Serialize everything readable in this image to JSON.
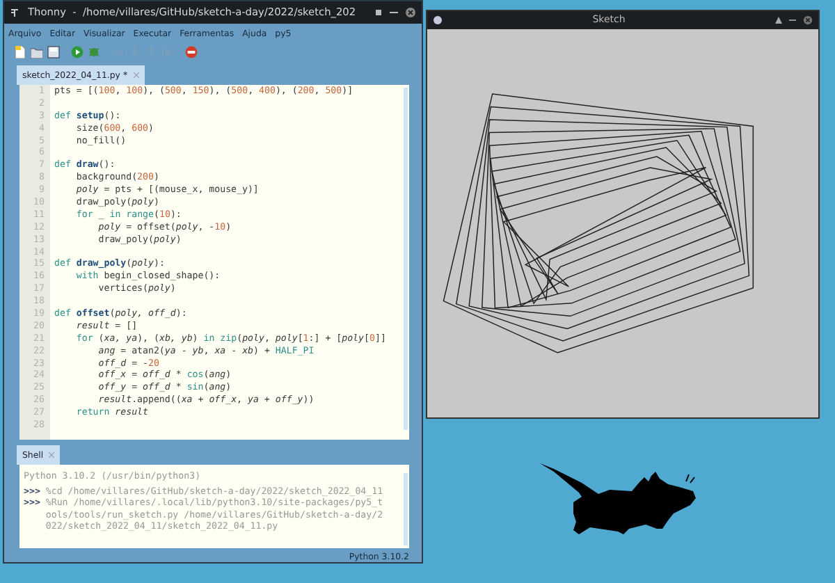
{
  "thonny_window": {
    "title": "Thonny  -  /home/villares/GitHub/sketch-a-day/2022/sketch_202",
    "menu": [
      "Arquivo",
      "Editar",
      "Visualizar",
      "Executar",
      "Ferramentas",
      "Ajuda",
      "py5"
    ],
    "toolbar": [
      {
        "kind": "new",
        "disabled": false
      },
      {
        "kind": "open",
        "disabled": false
      },
      {
        "kind": "save",
        "disabled": false
      },
      {
        "kind": "run",
        "disabled": false
      },
      {
        "kind": "debug",
        "disabled": false
      },
      {
        "kind": "step-over",
        "disabled": true
      },
      {
        "kind": "step-into",
        "disabled": true
      },
      {
        "kind": "step-out",
        "disabled": true
      },
      {
        "kind": "resume",
        "disabled": true
      },
      {
        "kind": "stop",
        "disabled": false
      }
    ],
    "editor_tabs": [
      {
        "label": "sketch_2022_04_11.py *",
        "selected": true
      }
    ],
    "code_lines": [
      {
        "number": "1",
        "tokens": [
          {
            "kind": "pl",
            "text": "pts = [("
          },
          {
            "kind": "num",
            "text": "100"
          },
          {
            "kind": "pl",
            "text": ", "
          },
          {
            "kind": "num",
            "text": "100"
          },
          {
            "kind": "pl",
            "text": "), ("
          },
          {
            "kind": "num",
            "text": "500"
          },
          {
            "kind": "pl",
            "text": ", "
          },
          {
            "kind": "num",
            "text": "150"
          },
          {
            "kind": "pl",
            "text": "), ("
          },
          {
            "kind": "num",
            "text": "500"
          },
          {
            "kind": "pl",
            "text": ", "
          },
          {
            "kind": "num",
            "text": "400"
          },
          {
            "kind": "pl",
            "text": "), ("
          },
          {
            "kind": "num",
            "text": "200"
          },
          {
            "kind": "pl",
            "text": ", "
          },
          {
            "kind": "num",
            "text": "500"
          },
          {
            "kind": "pl",
            "text": ")]"
          }
        ]
      },
      {
        "number": "2"
      },
      {
        "number": "3",
        "tokens": [
          {
            "kind": "kw",
            "text": "def "
          },
          {
            "kind": "fn",
            "text": "setup"
          },
          {
            "kind": "pl",
            "text": "():"
          }
        ]
      },
      {
        "number": "4",
        "tokens": [
          {
            "kind": "pl",
            "text": "    size("
          },
          {
            "kind": "num",
            "text": "600"
          },
          {
            "kind": "pl",
            "text": ", "
          },
          {
            "kind": "num",
            "text": "600"
          },
          {
            "kind": "pl",
            "text": ")"
          }
        ]
      },
      {
        "number": "5",
        "tokens": [
          {
            "kind": "pl",
            "text": "    no_fill()"
          }
        ]
      },
      {
        "number": "6"
      },
      {
        "number": "7",
        "tokens": [
          {
            "kind": "kw",
            "text": "def "
          },
          {
            "kind": "fn",
            "text": "draw"
          },
          {
            "kind": "pl",
            "text": "():"
          }
        ]
      },
      {
        "number": "8",
        "tokens": [
          {
            "kind": "pl",
            "text": "    background("
          },
          {
            "kind": "num",
            "text": "200"
          },
          {
            "kind": "pl",
            "text": ")"
          }
        ]
      },
      {
        "number": "9",
        "tokens": [
          {
            "kind": "it",
            "text": "    poly"
          },
          {
            "kind": "pl",
            "text": " = pts + [(mouse_x, mouse_y)]"
          }
        ]
      },
      {
        "number": "10",
        "tokens": [
          {
            "kind": "pl",
            "text": "    draw_poly("
          },
          {
            "kind": "it",
            "text": "poly"
          },
          {
            "kind": "pl",
            "text": ")"
          }
        ]
      },
      {
        "number": "11",
        "tokens": [
          {
            "kind": "kw",
            "text": "    for"
          },
          {
            "kind": "pl",
            "text": " _ "
          },
          {
            "kind": "kw",
            "text": "in"
          },
          {
            "kind": "bi",
            "text": " range"
          },
          {
            "kind": "pl",
            "text": "("
          },
          {
            "kind": "num",
            "text": "10"
          },
          {
            "kind": "pl",
            "text": "):"
          }
        ]
      },
      {
        "number": "12",
        "tokens": [
          {
            "kind": "it",
            "text": "        poly"
          },
          {
            "kind": "pl",
            "text": " = offset("
          },
          {
            "kind": "it",
            "text": "poly"
          },
          {
            "kind": "pl",
            "text": ", -"
          },
          {
            "kind": "num",
            "text": "10"
          },
          {
            "kind": "pl",
            "text": ")"
          }
        ]
      },
      {
        "number": "13",
        "tokens": [
          {
            "kind": "pl",
            "text": "        draw_poly("
          },
          {
            "kind": "it",
            "text": "poly"
          },
          {
            "kind": "pl",
            "text": ")"
          }
        ]
      },
      {
        "number": "14"
      },
      {
        "number": "15",
        "tokens": [
          {
            "kind": "kw",
            "text": "def "
          },
          {
            "kind": "fn",
            "text": "draw_poly"
          },
          {
            "kind": "pl",
            "text": "("
          },
          {
            "kind": "it",
            "text": "poly"
          },
          {
            "kind": "pl",
            "text": "):"
          }
        ]
      },
      {
        "number": "16",
        "tokens": [
          {
            "kind": "kw",
            "text": "    with"
          },
          {
            "kind": "pl",
            "text": " begin_closed_shape():"
          }
        ]
      },
      {
        "number": "17",
        "tokens": [
          {
            "kind": "pl",
            "text": "        vertices("
          },
          {
            "kind": "it",
            "text": "poly"
          },
          {
            "kind": "pl",
            "text": ")"
          }
        ]
      },
      {
        "number": "18"
      },
      {
        "number": "19",
        "tokens": [
          {
            "kind": "kw",
            "text": "def "
          },
          {
            "kind": "fn",
            "text": "offset"
          },
          {
            "kind": "pl",
            "text": "("
          },
          {
            "kind": "it",
            "text": "poly, off_d"
          },
          {
            "kind": "pl",
            "text": "):"
          }
        ]
      },
      {
        "number": "20",
        "tokens": [
          {
            "kind": "it",
            "text": "    result"
          },
          {
            "kind": "pl",
            "text": " = []"
          }
        ]
      },
      {
        "number": "21",
        "tokens": [
          {
            "kind": "kw",
            "text": "    for"
          },
          {
            "kind": "pl",
            "text": " ("
          },
          {
            "kind": "it",
            "text": "xa, ya"
          },
          {
            "kind": "pl",
            "text": "), ("
          },
          {
            "kind": "it",
            "text": "xb, yb"
          },
          {
            "kind": "pl",
            "text": ") "
          },
          {
            "kind": "kw",
            "text": "in"
          },
          {
            "kind": "bi",
            "text": " zip"
          },
          {
            "kind": "pl",
            "text": "("
          },
          {
            "kind": "it",
            "text": "poly"
          },
          {
            "kind": "pl",
            "text": ", "
          },
          {
            "kind": "it",
            "text": "poly"
          },
          {
            "kind": "pl",
            "text": "["
          },
          {
            "kind": "num",
            "text": "1"
          },
          {
            "kind": "pl",
            "text": ":] + ["
          },
          {
            "kind": "it",
            "text": "poly"
          },
          {
            "kind": "pl",
            "text": "["
          },
          {
            "kind": "num",
            "text": "0"
          },
          {
            "kind": "pl",
            "text": "]]"
          }
        ]
      },
      {
        "number": "22",
        "tokens": [
          {
            "kind": "it",
            "text": "        ang"
          },
          {
            "kind": "pl",
            "text": " = atan2("
          },
          {
            "kind": "it",
            "text": "ya"
          },
          {
            "kind": "pl",
            "text": " - "
          },
          {
            "kind": "it",
            "text": "yb"
          },
          {
            "kind": "pl",
            "text": ", "
          },
          {
            "kind": "it",
            "text": "xa"
          },
          {
            "kind": "pl",
            "text": " - "
          },
          {
            "kind": "it",
            "text": "xb"
          },
          {
            "kind": "pl",
            "text": ") + "
          },
          {
            "kind": "bi",
            "text": "HALF_PI"
          }
        ]
      },
      {
        "number": "23",
        "tokens": [
          {
            "kind": "it",
            "text": "        off_d"
          },
          {
            "kind": "pl",
            "text": " = -"
          },
          {
            "kind": "num",
            "text": "20"
          }
        ]
      },
      {
        "number": "24",
        "tokens": [
          {
            "kind": "it",
            "text": "        off_x"
          },
          {
            "kind": "pl",
            "text": " = "
          },
          {
            "kind": "it",
            "text": "off_d"
          },
          {
            "kind": "pl",
            "text": " * "
          },
          {
            "kind": "bi",
            "text": "cos"
          },
          {
            "kind": "pl",
            "text": "("
          },
          {
            "kind": "it",
            "text": "ang"
          },
          {
            "kind": "pl",
            "text": ")"
          }
        ]
      },
      {
        "number": "25",
        "tokens": [
          {
            "kind": "it",
            "text": "        off_y"
          },
          {
            "kind": "pl",
            "text": " = "
          },
          {
            "kind": "it",
            "text": "off_d"
          },
          {
            "kind": "pl",
            "text": " * "
          },
          {
            "kind": "bi",
            "text": "sin"
          },
          {
            "kind": "pl",
            "text": "("
          },
          {
            "kind": "it",
            "text": "ang"
          },
          {
            "kind": "pl",
            "text": ")"
          }
        ]
      },
      {
        "number": "26",
        "tokens": [
          {
            "kind": "it",
            "text": "        result"
          },
          {
            "kind": "pl",
            "text": ".append(("
          },
          {
            "kind": "it",
            "text": "xa"
          },
          {
            "kind": "pl",
            "text": " + "
          },
          {
            "kind": "it",
            "text": "off_x"
          },
          {
            "kind": "pl",
            "text": ", "
          },
          {
            "kind": "it",
            "text": "ya"
          },
          {
            "kind": "pl",
            "text": " + "
          },
          {
            "kind": "it",
            "text": "off_y"
          },
          {
            "kind": "pl",
            "text": "))"
          }
        ]
      },
      {
        "number": "27",
        "tokens": [
          {
            "kind": "kw",
            "text": "    return"
          },
          {
            "kind": "it",
            "text": " result"
          }
        ]
      },
      {
        "number": "28"
      }
    ],
    "shell_tabs": [
      {
        "label": "Shell",
        "selected": true
      }
    ],
    "shell_lines": [
      {
        "kind": "banner",
        "text": "Python 3.10.2 (/usr/bin/python3)"
      },
      {
        "kind": "command",
        "prompt": ">>>",
        "text": "%cd /home/villares/GitHub/sketch-a-day/2022/sketch_2022_04_11"
      },
      {
        "kind": "command",
        "prompt": ">>>",
        "text": "%Run /home/villares/.local/lib/python3.10/site-packages/py5_t"
      },
      {
        "kind": "continuation",
        "text": "ools/tools/run_sketch.py /home/villares/GitHub/sketch-a-day/2"
      },
      {
        "kind": "continuation",
        "text": "022/sketch_2022_04_11/sketch_2022_04_11.py"
      }
    ],
    "status_bar": "Python 3.10.2"
  },
  "sketch_window": {
    "title": "Sketch"
  }
}
